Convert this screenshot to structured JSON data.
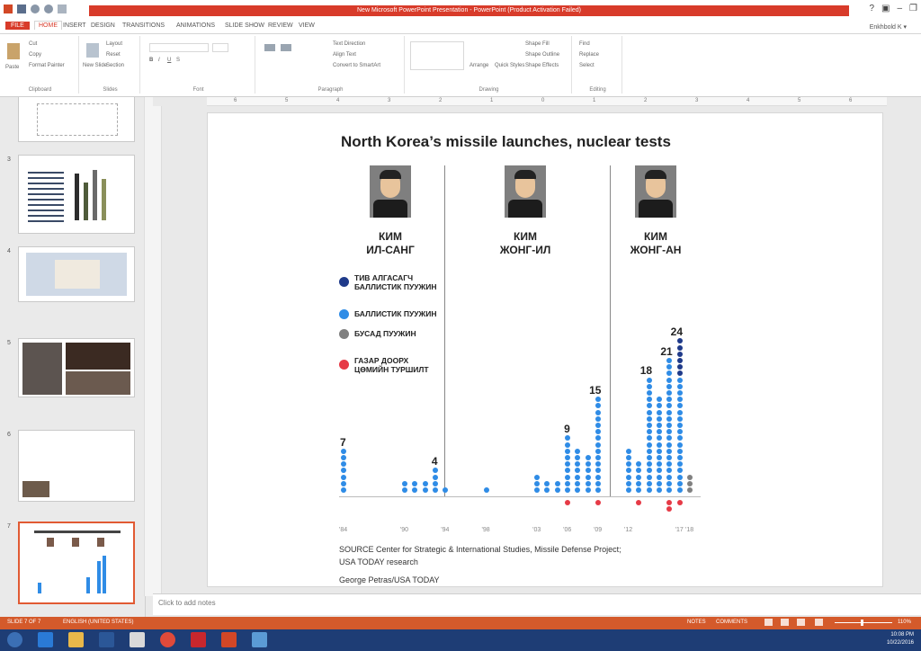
{
  "app": {
    "title": "New Microsoft PowerPoint Presentation - PowerPoint (Product Activation Failed)",
    "user": "Enkhbold K ▾"
  },
  "tabs": [
    "FILE",
    "HOME",
    "INSERT",
    "DESIGN",
    "TRANSITIONS",
    "ANIMATIONS",
    "SLIDE SHOW",
    "REVIEW",
    "VIEW"
  ],
  "ribbon": {
    "groups": [
      "Clipboard",
      "Slides",
      "Font",
      "Paragraph",
      "Drawing",
      "Editing"
    ],
    "paste": "Paste",
    "cut": "Cut",
    "copy": "Copy",
    "format_painter": "Format Painter",
    "new_slide": "New Slide",
    "layout": "Layout",
    "reset": "Reset",
    "section": "Section",
    "text_direction": "Text Direction",
    "align_text": "Align Text",
    "convert_smartart": "Convert to SmartArt",
    "arrange": "Arrange",
    "quick_styles": "Quick Styles",
    "shape_fill": "Shape Fill",
    "shape_outline": "Shape Outline",
    "shape_effects": "Shape Effects",
    "find": "Find",
    "replace": "Replace",
    "select": "Select"
  },
  "thumbnails": [
    "3",
    "4",
    "5",
    "6",
    "7"
  ],
  "ruler_numbers": [
    "6",
    "5",
    "4",
    "3",
    "2",
    "1",
    "0",
    "1",
    "2",
    "3",
    "4",
    "5",
    "6"
  ],
  "slide": {
    "title": "North Korea’s missile launches, nuclear tests",
    "leaders": [
      {
        "line1": "КИМ",
        "line2": "ИЛ-САНГ"
      },
      {
        "line1": "КИМ",
        "line2": "ЖОНГ-ИЛ"
      },
      {
        "line1": "КИМ",
        "line2": "ЖОНГ-АН"
      }
    ],
    "legend": [
      {
        "line1": "ТИВ АЛГАСАГЧ",
        "line2": "БАЛЛИСТИК ПУУЖИН",
        "color": "#1f3a8a"
      },
      {
        "line1": "БАЛЛИСТИК ПУУЖИН",
        "line2": "",
        "color": "#2f8ce6"
      },
      {
        "line1": "БУСАД ПУУЖИН",
        "line2": "",
        "color": "#808080"
      },
      {
        "line1": "ГАЗАР ДООРХ",
        "line2": "ЦӨМИЙН ТУРШИЛТ",
        "color": "#e63a46"
      }
    ],
    "source1": "SOURCE Center for Strategic & International Studies, Missile Defense Project;",
    "source2": "USA TODAY research",
    "credit": "George Petras/USA TODAY"
  },
  "notes": "Click to add notes",
  "status": {
    "slide": "SLIDE 7 OF 7",
    "lang": "ENGLISH (UNITED STATES)",
    "notes": "NOTES",
    "comments": "COMMENTS",
    "zoom": "110%"
  },
  "clock": {
    "time": "10:08 PM",
    "date": "10/22/2016"
  },
  "chart_data": {
    "type": "dot-column",
    "years": [
      1984,
      1985,
      1986,
      1987,
      1988,
      1989,
      1990,
      1991,
      1992,
      1993,
      1994,
      1995,
      1996,
      1997,
      1998,
      1999,
      2000,
      2001,
      2002,
      2003,
      2004,
      2005,
      2006,
      2007,
      2008,
      2009,
      2010,
      2011,
      2012,
      2013,
      2014,
      2015,
      2016,
      2017,
      2018
    ],
    "x_tick_labels": [
      "'84",
      "'90",
      "'94",
      "'98",
      "'03",
      "'06",
      "'09",
      "'12",
      "'17",
      "'18"
    ],
    "series": [
      {
        "name": "ТИВ АЛГАСАГЧ БАЛЛИСТИК ПУУЖИН",
        "color": "#1f3a8a",
        "values": [
          0,
          0,
          0,
          0,
          0,
          0,
          0,
          0,
          0,
          0,
          0,
          0,
          0,
          0,
          0,
          0,
          0,
          0,
          0,
          0,
          0,
          0,
          0,
          0,
          0,
          0,
          0,
          0,
          0,
          0,
          0,
          0,
          0,
          6,
          0
        ]
      },
      {
        "name": "БАЛЛИСТИК ПУУЖИН",
        "color": "#2f8ce6",
        "values": [
          7,
          0,
          0,
          0,
          0,
          0,
          2,
          2,
          2,
          4,
          1,
          0,
          0,
          0,
          1,
          0,
          0,
          0,
          0,
          3,
          2,
          2,
          9,
          7,
          6,
          15,
          0,
          0,
          7,
          5,
          18,
          15,
          21,
          18,
          0
        ]
      },
      {
        "name": "БУСАД ПУУЖИН",
        "color": "#808080",
        "values": [
          0,
          0,
          0,
          0,
          0,
          0,
          0,
          0,
          0,
          0,
          0,
          0,
          0,
          0,
          0,
          0,
          0,
          0,
          0,
          0,
          0,
          0,
          0,
          0,
          0,
          0,
          0,
          0,
          0,
          0,
          0,
          0,
          0,
          0,
          3
        ]
      },
      {
        "name": "ГАЗАР ДООРХ ЦӨМИЙН ТУРШИЛТ",
        "color": "#e63a46",
        "values": [
          0,
          0,
          0,
          0,
          0,
          0,
          0,
          0,
          0,
          0,
          0,
          0,
          0,
          0,
          0,
          0,
          0,
          0,
          0,
          0,
          0,
          0,
          1,
          0,
          0,
          1,
          0,
          0,
          0,
          1,
          0,
          0,
          2,
          1,
          0
        ]
      }
    ],
    "value_labels": [
      {
        "year": 1984,
        "text": "7"
      },
      {
        "year": 1993,
        "text": "4"
      },
      {
        "year": 2006,
        "text": "9"
      },
      {
        "year": 2009,
        "text": "15"
      },
      {
        "year": 2014,
        "text": "18"
      },
      {
        "year": 2016,
        "text": "21"
      },
      {
        "year": 2017,
        "text": "24"
      }
    ]
  }
}
